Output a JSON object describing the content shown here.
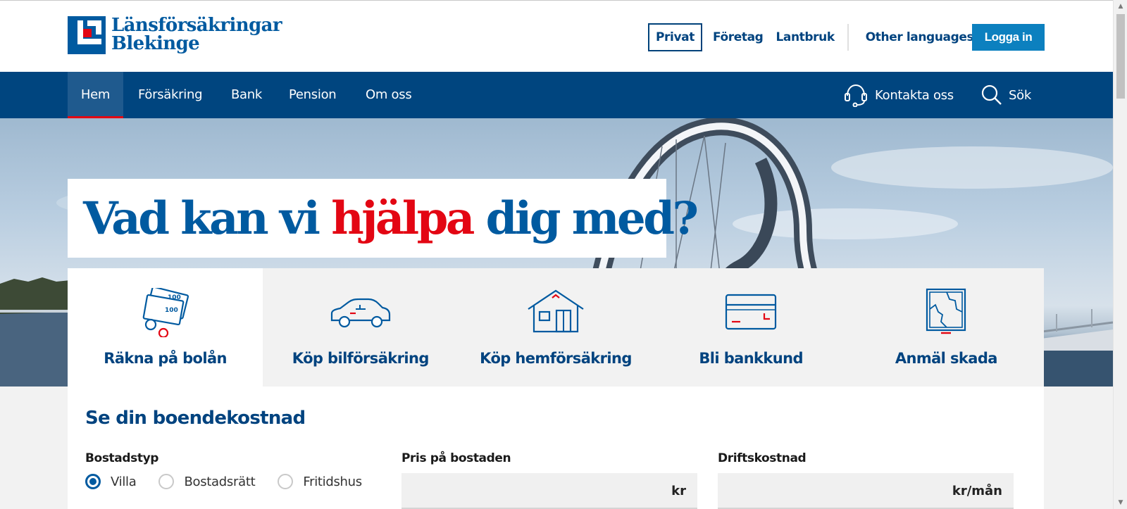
{
  "brand": {
    "line1": "Länsförsäkringar",
    "line2": "Blekinge",
    "colors": {
      "primary": "#005aa0",
      "dark": "#00457f",
      "accent": "#e30613",
      "button": "#0c80bf"
    }
  },
  "toplinks": {
    "items": [
      {
        "label": "Privat",
        "active": true
      },
      {
        "label": "Företag"
      },
      {
        "label": "Lantbruk"
      }
    ],
    "other_languages": "Other languages",
    "login": "Logga in"
  },
  "nav": {
    "items": [
      {
        "label": "Hem",
        "active": true
      },
      {
        "label": "Försäkring"
      },
      {
        "label": "Bank"
      },
      {
        "label": "Pension"
      },
      {
        "label": "Om oss"
      }
    ],
    "contact": {
      "label": "Kontakta oss",
      "icon": "headset-icon"
    },
    "search": {
      "label": "Sök",
      "icon": "search-icon"
    }
  },
  "hero": {
    "headline_before": "Vad kan vi ",
    "headline_accent": "hjälpa",
    "headline_after": " dig med?"
  },
  "quicklinks": [
    {
      "label": "Räkna på bolån",
      "icon": "money-bills-icon",
      "active": true
    },
    {
      "label": "Köp bilförsäkring",
      "icon": "car-icon"
    },
    {
      "label": "Köp hemförsäkring",
      "icon": "house-icon"
    },
    {
      "label": "Bli bankkund",
      "icon": "bank-card-icon"
    },
    {
      "label": "Anmäl skada",
      "icon": "broken-window-icon"
    }
  ],
  "calculator": {
    "title": "Se din boendekostnad",
    "housing_type": {
      "label": "Bostadstyp",
      "options": [
        "Villa",
        "Bostadsrätt",
        "Fritidshus"
      ],
      "selected": "Villa"
    },
    "price": {
      "label": "Pris på bostaden",
      "unit": "kr",
      "value": ""
    },
    "operating_cost": {
      "label": "Driftskostnad",
      "unit": "kr/mån",
      "value": ""
    }
  }
}
